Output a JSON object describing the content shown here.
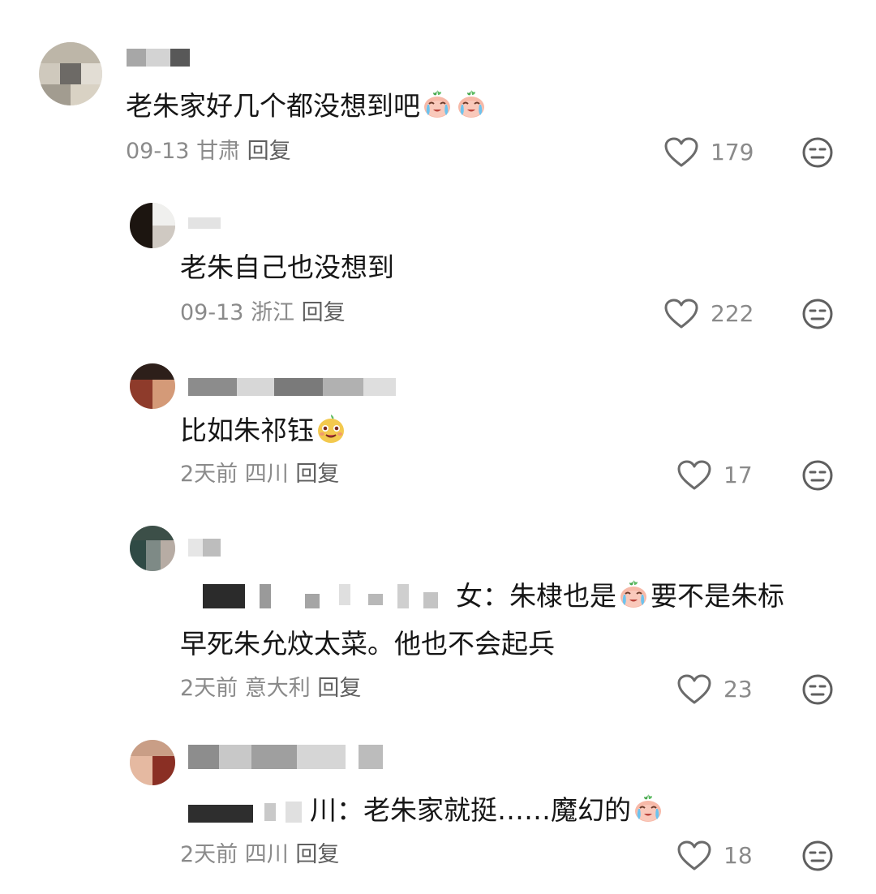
{
  "comments": [
    {
      "text_before": "老朱家好几个都没想到吧",
      "text_after": "",
      "date": "09-13",
      "location": "甘肃",
      "reply_label": "回复",
      "likes": "179",
      "emojis": [
        "crying-emoji",
        "crying-emoji"
      ]
    },
    {
      "text_before": "老朱自己也没想到",
      "text_after": "",
      "date": "09-13",
      "location": "浙江",
      "reply_label": "回复",
      "likes": "222"
    },
    {
      "text_before": "比如朱祁钰",
      "text_after": "",
      "date": "2天前",
      "location": "四川",
      "reply_label": "回复",
      "likes": "17",
      "emojis": [
        "smirk-emoji"
      ]
    },
    {
      "text_before": "女：朱棣也是",
      "text_after": "要不是朱标",
      "text_line2": "早死朱允炆太菜。他也不会起兵",
      "date": "2天前",
      "location": "意大利",
      "reply_label": "回复",
      "likes": "23",
      "emojis": [
        "crying-emoji"
      ]
    },
    {
      "text_before": "川：老朱家就挺……魔幻的",
      "text_after": "",
      "date": "2天前",
      "location": "四川",
      "reply_label": "回复",
      "likes": "18",
      "emojis": [
        "crying-emoji"
      ]
    }
  ],
  "colors": {
    "text": "#161616",
    "meta": "#8a8a8a",
    "reply": "#5f5f5f",
    "icon": "#6b6b6b"
  }
}
